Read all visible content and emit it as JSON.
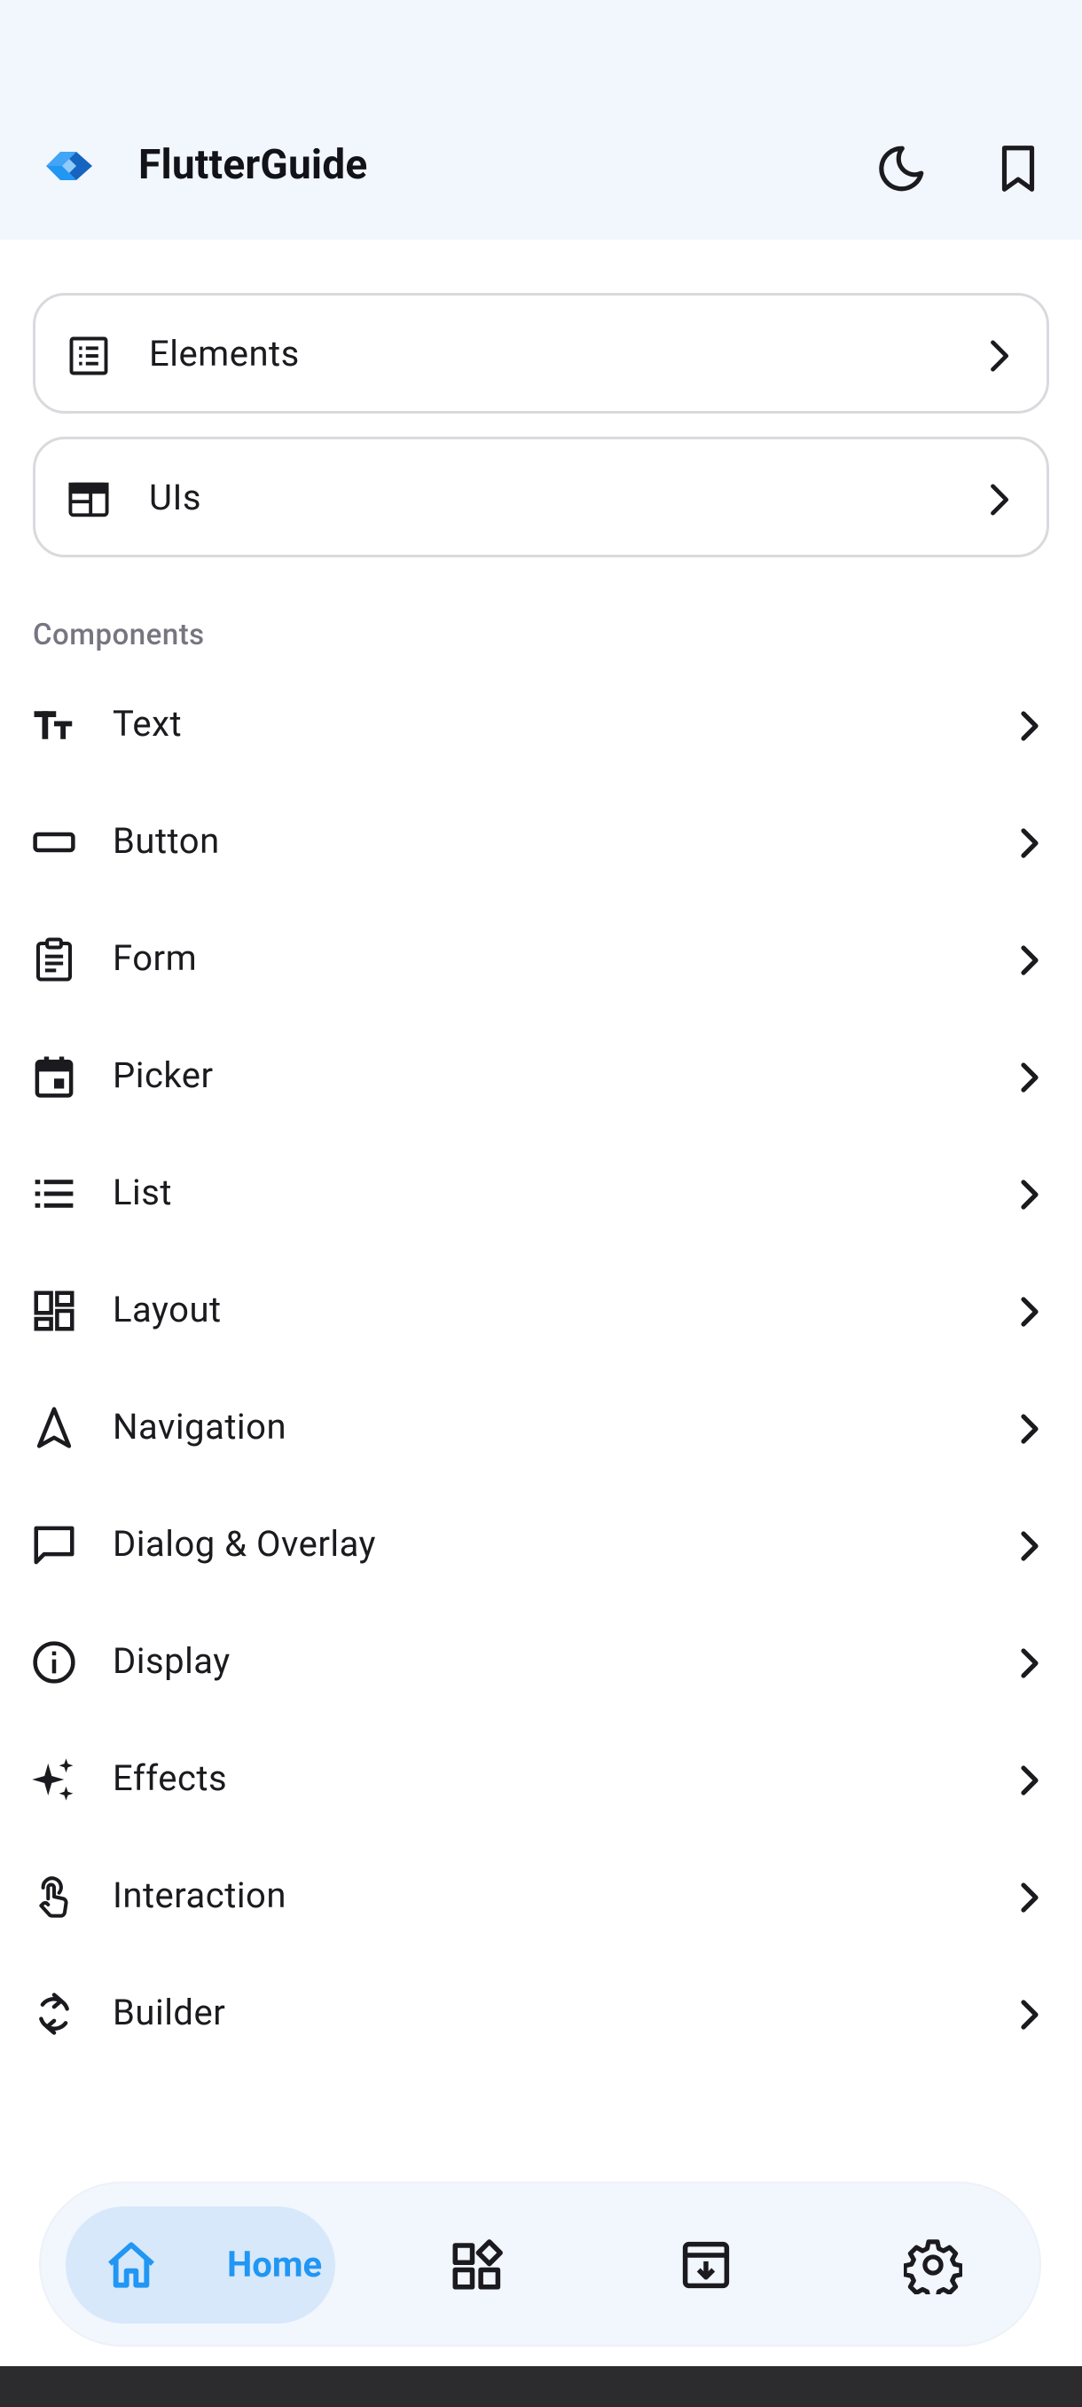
{
  "header": {
    "title": "FlutterGuide",
    "logo_icon": "flutter-logo-icon",
    "theme_toggle_icon": "moon-icon",
    "bookmark_icon": "bookmark-icon"
  },
  "cards": [
    {
      "label": "Elements",
      "icon": "list-alt-icon"
    },
    {
      "label": "UIs",
      "icon": "web-layout-icon"
    }
  ],
  "components": {
    "section_label": "Components",
    "items": [
      {
        "label": "Text",
        "icon": "text-fields-icon"
      },
      {
        "label": "Button",
        "icon": "button-outline-icon"
      },
      {
        "label": "Form",
        "icon": "clipboard-icon"
      },
      {
        "label": "Picker",
        "icon": "calendar-icon"
      },
      {
        "label": "List",
        "icon": "list-icon"
      },
      {
        "label": "Layout",
        "icon": "dashboard-icon"
      },
      {
        "label": "Navigation",
        "icon": "navigation-arrow-icon"
      },
      {
        "label": "Dialog & Overlay",
        "icon": "chat-bubble-icon"
      },
      {
        "label": "Display",
        "icon": "info-icon"
      },
      {
        "label": "Effects",
        "icon": "sparkle-icon"
      },
      {
        "label": "Interaction",
        "icon": "touch-icon"
      },
      {
        "label": "Builder",
        "icon": "refresh-icon"
      }
    ]
  },
  "bottom_nav": {
    "home_label": "Home",
    "active": "Home",
    "accent_color": "#2196f3",
    "active_bg": "#d7e8fb"
  },
  "colors": {
    "appbar_bg": "#f2f6fd",
    "card_border": "#d9d9de",
    "section_label": "#767680",
    "text": "#1b1b1f"
  }
}
